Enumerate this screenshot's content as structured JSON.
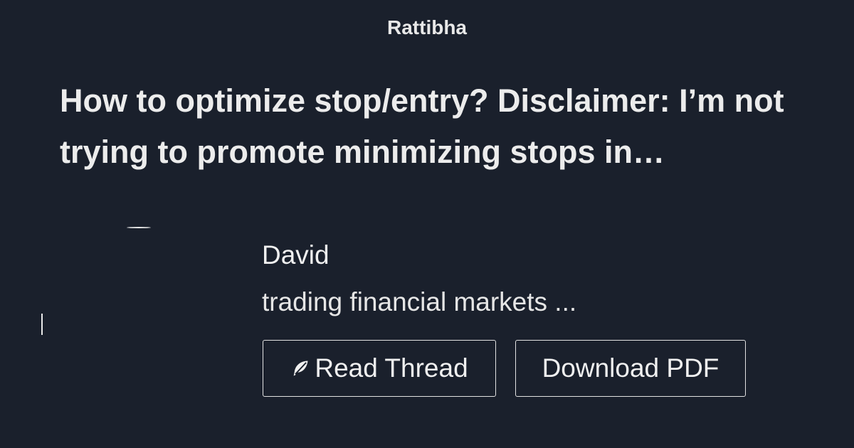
{
  "brand": {
    "name": "Rattibha"
  },
  "thread": {
    "title": "How to optimize stop/entry? Disclaimer: I’m not trying to promote minimizing stops in…"
  },
  "author": {
    "name": "David",
    "bio": "trading financial markets ..."
  },
  "actions": {
    "read_label": "Read Thread",
    "read_icon": "feather-icon",
    "pdf_label": "Download PDF"
  },
  "colors": {
    "background": "#1a202c",
    "text": "#e8e8e8",
    "button_border": "#e2e2e2"
  }
}
